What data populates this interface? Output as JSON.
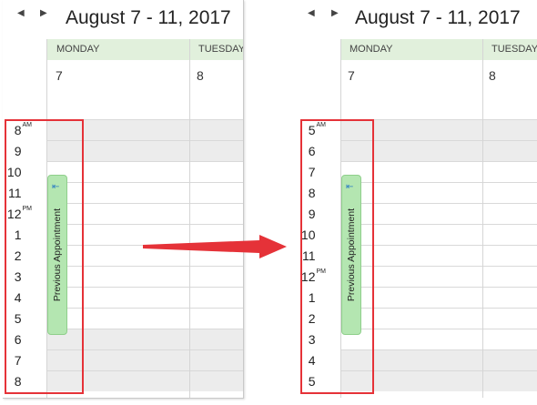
{
  "left": {
    "nav_prev": "◀",
    "nav_next": "▶",
    "title": "August 7 - 11, 2017",
    "days": [
      {
        "name": "MONDAY",
        "date": "7"
      },
      {
        "name": "TUESDAY",
        "date": "8"
      }
    ],
    "hours": [
      {
        "h": "8",
        "s": "AM"
      },
      {
        "h": "9",
        "s": ""
      },
      {
        "h": "10",
        "s": ""
      },
      {
        "h": "11",
        "s": ""
      },
      {
        "h": "12",
        "s": "PM"
      },
      {
        "h": "1",
        "s": ""
      },
      {
        "h": "2",
        "s": ""
      },
      {
        "h": "3",
        "s": ""
      },
      {
        "h": "4",
        "s": ""
      },
      {
        "h": "5",
        "s": ""
      },
      {
        "h": "6",
        "s": ""
      },
      {
        "h": "7",
        "s": ""
      },
      {
        "h": "8",
        "s": ""
      }
    ],
    "appointment": {
      "icon": "⇤",
      "label": "Previous Appointment"
    }
  },
  "right": {
    "nav_prev": "◀",
    "nav_next": "▶",
    "title": "August 7 - 11, 2017",
    "days": [
      {
        "name": "MONDAY",
        "date": "7"
      },
      {
        "name": "TUESDAY",
        "date": "8"
      }
    ],
    "hours": [
      {
        "h": "5",
        "s": "AM"
      },
      {
        "h": "6",
        "s": ""
      },
      {
        "h": "7",
        "s": ""
      },
      {
        "h": "8",
        "s": ""
      },
      {
        "h": "9",
        "s": ""
      },
      {
        "h": "10",
        "s": ""
      },
      {
        "h": "11",
        "s": ""
      },
      {
        "h": "12",
        "s": "PM"
      },
      {
        "h": "1",
        "s": ""
      },
      {
        "h": "2",
        "s": ""
      },
      {
        "h": "3",
        "s": ""
      },
      {
        "h": "4",
        "s": ""
      },
      {
        "h": "5",
        "s": ""
      }
    ],
    "appointment": {
      "icon": "⇤",
      "label": "Previous Appointment"
    }
  },
  "colors": {
    "highlight": "#e53238",
    "appointment": "#b4e6b1",
    "day_header": "#e1f0dc",
    "off_hours": "#ececec"
  }
}
